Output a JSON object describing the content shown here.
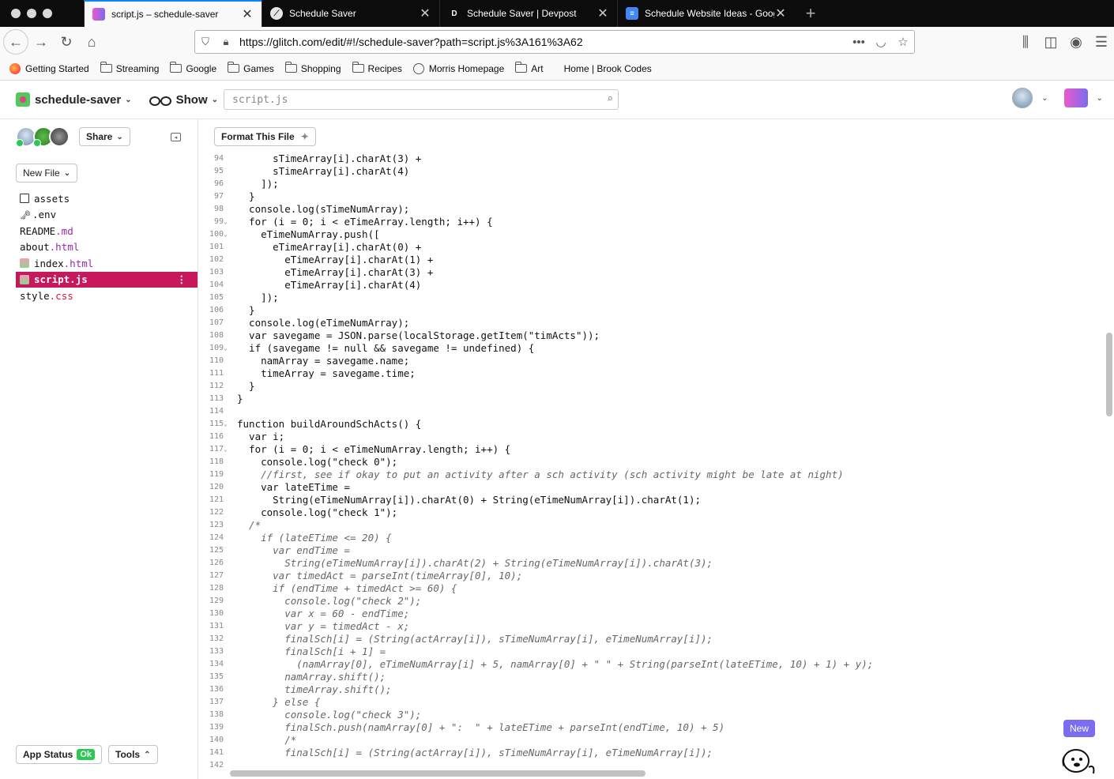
{
  "tabs": [
    {
      "label": "script.js – schedule-saver",
      "active": true,
      "favicon": "glitch-fish-icon"
    },
    {
      "label": "Schedule Saver",
      "active": false,
      "favicon": "glitch-leaf-icon"
    },
    {
      "label": "Schedule Saver | Devpost",
      "active": false,
      "favicon": "devpost-icon"
    },
    {
      "label": "Schedule Website Ideas - Goog",
      "active": false,
      "favicon": "google-docs-icon"
    }
  ],
  "url": "https://glitch.com/edit/#!/schedule-saver?path=script.js%3A161%3A62",
  "bookmarks": [
    "Getting Started",
    "Streaming",
    "Google",
    "Games",
    "Shopping",
    "Recipes",
    "Morris Homepage",
    "Art",
    "Home | Brook Codes"
  ],
  "header": {
    "project": "schedule-saver",
    "show": "Show",
    "search_placeholder": "script.js"
  },
  "sidebar": {
    "share": "Share",
    "new_file": "New File",
    "files": [
      {
        "name": "assets",
        "ext": ""
      },
      {
        "name": ".env",
        "ext": ""
      },
      {
        "name": "README",
        "ext": ".md"
      },
      {
        "name": "about",
        "ext": ".html"
      },
      {
        "name": "index",
        "ext": ".html"
      },
      {
        "name": "script",
        "ext": ".js"
      },
      {
        "name": "style",
        "ext": ".css"
      }
    ],
    "app_status": "App Status",
    "app_status_badge": "Ok",
    "tools": "Tools"
  },
  "editor": {
    "format_button": "Format This File",
    "new_badge": "New",
    "lines": [
      {
        "n": "94",
        "t": "      sTimeArray[i].charAt(3) +"
      },
      {
        "n": "95",
        "t": "      sTimeArray[i].charAt(4)"
      },
      {
        "n": "96",
        "t": "    ]);"
      },
      {
        "n": "97",
        "t": "  }"
      },
      {
        "n": "98",
        "t": "  console.log(sTimeNumArray);"
      },
      {
        "n": "99",
        "t": "  for (i = 0; i < eTimeArray.length; i++) {",
        "f": true
      },
      {
        "n": "100",
        "t": "    eTimeNumArray.push([",
        "f": true
      },
      {
        "n": "101",
        "t": "      eTimeArray[i].charAt(0) +"
      },
      {
        "n": "102",
        "t": "        eTimeArray[i].charAt(1) +"
      },
      {
        "n": "103",
        "t": "        eTimeArray[i].charAt(3) +"
      },
      {
        "n": "104",
        "t": "        eTimeArray[i].charAt(4)"
      },
      {
        "n": "105",
        "t": "    ]);"
      },
      {
        "n": "106",
        "t": "  }"
      },
      {
        "n": "107",
        "t": "  console.log(eTimeNumArray);"
      },
      {
        "n": "108",
        "t": "  var savegame = JSON.parse(localStorage.getItem(\"timActs\"));"
      },
      {
        "n": "109",
        "t": "  if (savegame != null && savegame != undefined) {",
        "f": true
      },
      {
        "n": "110",
        "t": "    namArray = savegame.name;"
      },
      {
        "n": "111",
        "t": "    timeArray = savegame.time;"
      },
      {
        "n": "112",
        "t": "  }"
      },
      {
        "n": "113",
        "t": "}"
      },
      {
        "n": "114",
        "t": ""
      },
      {
        "n": "115",
        "t": "function buildAroundSchActs() {",
        "f": true
      },
      {
        "n": "116",
        "t": "  var i;"
      },
      {
        "n": "117",
        "t": "  for (i = 0; i < eTimeNumArray.length; i++) {",
        "f": true
      },
      {
        "n": "118",
        "t": "    console.log(\"check 0\");"
      },
      {
        "n": "119",
        "t": "    //first, see if okay to put an activity after a sch activity (sch activity might be late at night)",
        "c": true
      },
      {
        "n": "120",
        "t": "    var lateETime ="
      },
      {
        "n": "121",
        "t": "      String(eTimeNumArray[i]).charAt(0) + String(eTimeNumArray[i]).charAt(1);"
      },
      {
        "n": "122",
        "t": "    console.log(\"check 1\");"
      },
      {
        "n": "123",
        "t": "  /*",
        "c": true
      },
      {
        "n": "124",
        "t": "    if (lateETime <= 20) {",
        "c": true
      },
      {
        "n": "125",
        "t": "      var endTime =",
        "c": true
      },
      {
        "n": "126",
        "t": "        String(eTimeNumArray[i]).charAt(2) + String(eTimeNumArray[i]).charAt(3);",
        "c": true
      },
      {
        "n": "127",
        "t": "      var timedAct = parseInt(timeArray[0], 10);",
        "c": true
      },
      {
        "n": "128",
        "t": "      if (endTime + timedAct >= 60) {",
        "c": true
      },
      {
        "n": "129",
        "t": "        console.log(\"check 2\");",
        "c": true
      },
      {
        "n": "130",
        "t": "        var x = 60 - endTime;",
        "c": true
      },
      {
        "n": "131",
        "t": "        var y = timedAct - x;",
        "c": true
      },
      {
        "n": "132",
        "t": "        finalSch[i] = (String(actArray[i]), sTimeNumArray[i], eTimeNumArray[i]);",
        "c": true
      },
      {
        "n": "133",
        "t": "        finalSch[i + 1] =",
        "c": true
      },
      {
        "n": "134",
        "t": "          (namArray[0], eTimeNumArray[i] + 5, namArray[0] + \" \" + String(parseInt(lateETime, 10) + 1) + y);",
        "c": true
      },
      {
        "n": "135",
        "t": "        namArray.shift();",
        "c": true
      },
      {
        "n": "136",
        "t": "        timeArray.shift();",
        "c": true
      },
      {
        "n": "137",
        "t": "      } else {",
        "c": true
      },
      {
        "n": "138",
        "t": "        console.log(\"check 3\");",
        "c": true
      },
      {
        "n": "139",
        "t": "        finalSch.push(namArray[0] + \":  \" + lateETime + parseInt(endTime, 10) + 5)",
        "c": true
      },
      {
        "n": "140",
        "t": "        /*",
        "c": true
      },
      {
        "n": "141",
        "t": "        finalSch[i] = (String(actArray[i]), sTimeNumArray[i], eTimeNumArray[i]);",
        "c": true
      },
      {
        "n": "142",
        "t": "",
        "c": true
      }
    ]
  }
}
